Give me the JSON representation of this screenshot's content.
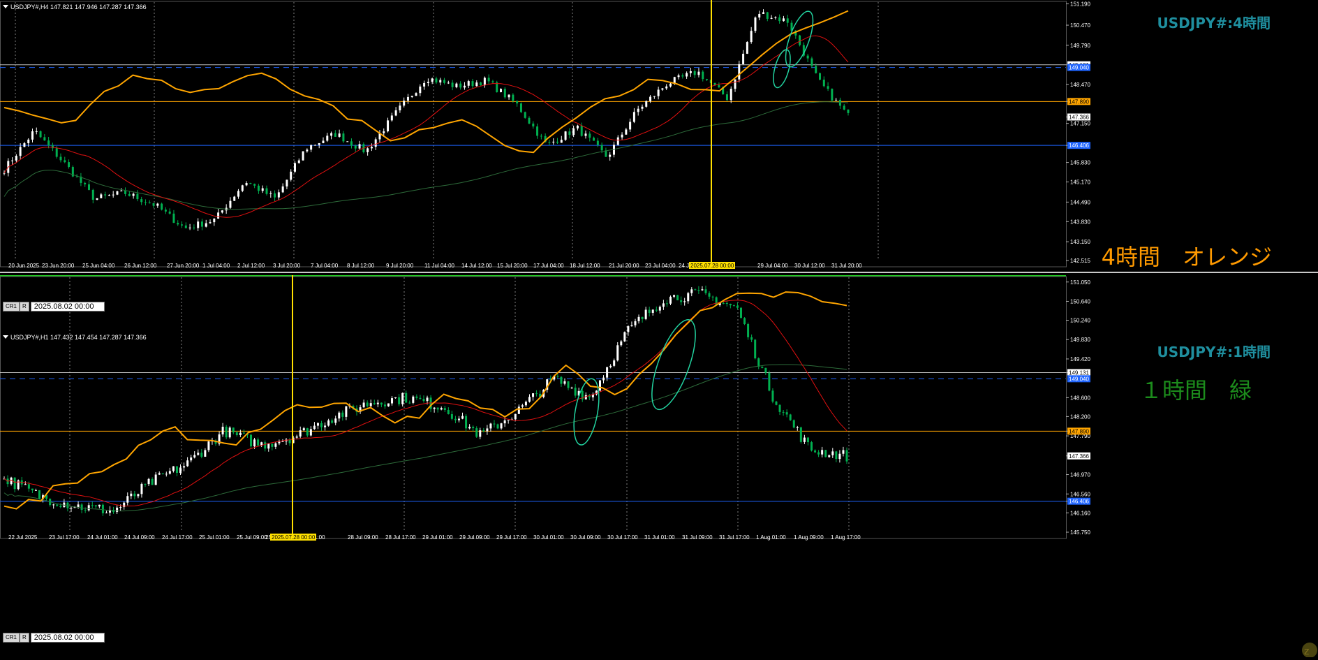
{
  "colors": {
    "bull": "#ffffff",
    "bear": "#00b050",
    "ma_fast": "#e01010",
    "ma_slow": "#2d6b3a",
    "zigzag": "#ffa500",
    "circle": "#22d3a0",
    "vline": "#ffe000",
    "orange_level": "#ffa500",
    "blue_level": "#1e64ff",
    "white_level": "#c0c0c0",
    "title": "#1f8f9f",
    "grid": "#808080"
  },
  "top": {
    "header": "USDJPY#,H4  147.821 147.946 147.287 147.366",
    "title": "USDJPY#:4時間",
    "note": "4時間　オレンジ",
    "note_color": "#ff9a00",
    "nav_buttons": [
      "CR1",
      "R"
    ],
    "nav_date": "2025.08.02 00:00",
    "vline_label": "2025.07.28 00:00",
    "y_range": [
      142.515,
      151.25
    ],
    "price_ticks": [
      "151.190",
      "150.470",
      "149.790",
      "149.131",
      "148.470",
      "147.890",
      "147.366",
      "147.150",
      "146.406",
      "145.830",
      "145.170",
      "144.490",
      "143.830",
      "143.150",
      "142.515"
    ],
    "price_tick_values": [
      151.19,
      150.47,
      149.79,
      149.131,
      148.47,
      147.89,
      147.366,
      147.15,
      146.406,
      145.83,
      145.17,
      144.49,
      143.83,
      143.15,
      142.515
    ],
    "levels": [
      {
        "price": 149.131,
        "type": "white"
      },
      {
        "price": 149.04,
        "type": "blue-dash"
      },
      {
        "price": 147.89,
        "type": "orange"
      },
      {
        "price": 146.406,
        "type": "blue"
      }
    ],
    "level_labels": [
      {
        "text": "149.131",
        "price": 149.131,
        "bg": "#ffffff",
        "fg": "#000000"
      },
      {
        "text": "149.040",
        "price": 149.04,
        "bg": "#1e64ff",
        "fg": "#ffffff"
      },
      {
        "text": "147.890",
        "price": 147.89,
        "bg": "#ffa500",
        "fg": "#000000"
      },
      {
        "text": "147.366",
        "price": 147.366,
        "bg": "#ffffff",
        "fg": "#000000"
      },
      {
        "text": "146.406",
        "price": 146.406,
        "bg": "#1e64ff",
        "fg": "#ffffff"
      }
    ],
    "time_labels": [
      "20 Jun 2025",
      "23 Jun 20:00",
      "25 Jun 04:00",
      "26 Jun 12:00",
      "27 Jun 20:00",
      "1 Jul 04:00",
      "2 Jul 12:00",
      "3 Jul 20:00",
      "7 Jul 04:00",
      "8 Jul 12:00",
      "9 Jul 20:00",
      "11 Jul 04:00",
      "14 Jul 12:00",
      "15 Jul 20:00",
      "17 Jul 04:00",
      "18 Jul 12:00",
      "21 Jul 20:00",
      "23 Jul 04:00",
      "24 Jul 1",
      "29 Jul 04:00",
      "30 Jul 12:00",
      "31 Jul 20:00"
    ]
  },
  "bottom": {
    "header": "USDJPY#,H1  147.432 147.454 147.287 147.366",
    "title": "USDJPY#:1時間",
    "note": "１時間　緑",
    "note_color": "#1c8c1c",
    "nav_buttons": [
      "CR1",
      "R"
    ],
    "nav_date": "2025.08.02 00:00",
    "vline_label": "2025.07.28 00:00",
    "y_range": [
      145.75,
      151.15
    ],
    "price_ticks": [
      "151.050",
      "150.640",
      "150.240",
      "149.830",
      "149.420",
      "149.131",
      "148.600",
      "148.200",
      "147.890",
      "147.790",
      "147.366",
      "146.970",
      "146.560",
      "146.406",
      "146.160",
      "145.750"
    ],
    "price_tick_values": [
      151.05,
      150.64,
      150.24,
      149.83,
      149.42,
      149.131,
      148.6,
      148.2,
      147.89,
      147.79,
      147.366,
      146.97,
      146.56,
      146.406,
      146.16,
      145.75
    ],
    "levels": [
      {
        "price": 149.131,
        "type": "white"
      },
      {
        "price": 149.0,
        "type": "blue-dash"
      },
      {
        "price": 147.89,
        "type": "orange"
      },
      {
        "price": 146.406,
        "type": "blue"
      }
    ],
    "level_labels": [
      {
        "text": "149.131",
        "price": 149.131,
        "bg": "#ffffff",
        "fg": "#000000"
      },
      {
        "text": "149.040",
        "price": 149.0,
        "bg": "#1e64ff",
        "fg": "#ffffff"
      },
      {
        "text": "147.890",
        "price": 147.89,
        "bg": "#ffa500",
        "fg": "#000000"
      },
      {
        "text": "147.366",
        "price": 147.366,
        "bg": "#ffffff",
        "fg": "#000000"
      },
      {
        "text": "146.406",
        "price": 146.406,
        "bg": "#1e64ff",
        "fg": "#ffffff"
      }
    ],
    "time_labels": [
      "22 Jul 2025",
      "23 Jul 17:00",
      "24 Jul 01:00",
      "24 Jul 09:00",
      "24 Jul 17:00",
      "25 Jul 01:00",
      "25 Jul 09:00",
      "25 J",
      "1:00",
      "28 Jul 09:00",
      "28 Jul 17:00",
      "29 Jul 01:00",
      "29 Jul 09:00",
      "29 Jul 17:00",
      "30 Jul 01:00",
      "30 Jul 09:00",
      "30 Jul 17:00",
      "31 Jul 01:00",
      "31 Jul 09:00",
      "31 Jul 17:00",
      "1 Aug 01:00",
      "1 Aug 09:00",
      "1 Aug 17:00"
    ]
  }
}
